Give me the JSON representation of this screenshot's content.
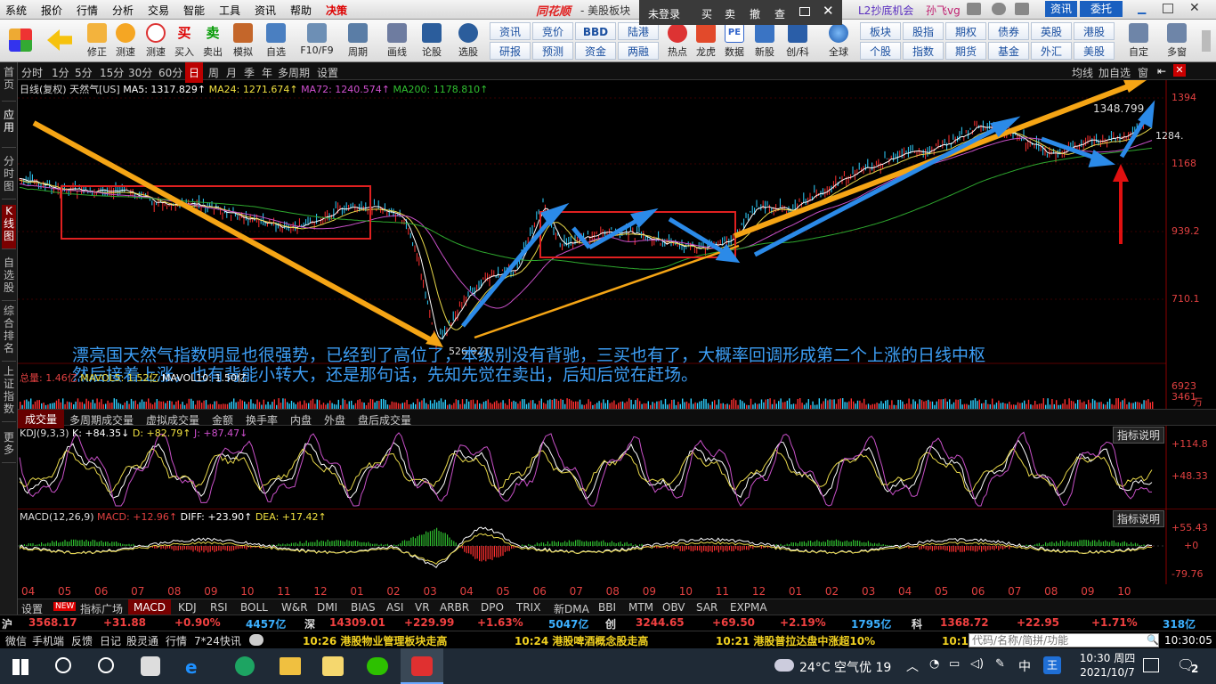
{
  "menu": {
    "items": [
      "系统",
      "报价",
      "行情",
      "分析",
      "交易",
      "智能",
      "工具",
      "资讯",
      "帮助",
      "决策"
    ],
    "app_brand": "同花顺",
    "title_suffix": "- 美股板块",
    "login": "未登录",
    "buy": "买",
    "sell": "卖",
    "cancel": "撤",
    "query": "查",
    "l2": "L2抄底机会",
    "user": "孙飞vg",
    "news_btn": "资讯",
    "trust_btn": "委托"
  },
  "toolbar": {
    "buttons": [
      {
        "label": "",
        "icon": "grid-icon"
      },
      {
        "label": "",
        "icon": "back-arrow-icon"
      },
      {
        "label": "修正",
        "icon": "updown-icon"
      },
      {
        "label": "测速",
        "icon": "speed-icon"
      },
      {
        "label": "买入",
        "icon": "buy-icon"
      },
      {
        "label": "卖出",
        "icon": "sell-icon"
      },
      {
        "label": "模拟",
        "icon": "hammer-icon"
      },
      {
        "label": "自选",
        "icon": "star-icon"
      },
      {
        "label": "F10/F9",
        "icon": "f10-icon"
      },
      {
        "label": "周期",
        "icon": "clock-icon"
      },
      {
        "label": "画线",
        "icon": "pen-icon"
      },
      {
        "label": "论股",
        "icon": "discuss-icon"
      },
      {
        "label": "选股",
        "icon": "search-icon"
      }
    ],
    "quick_top": [
      "资讯",
      "竞价",
      "BBD",
      "陆港"
    ],
    "quick_bottom": [
      "研报",
      "预测",
      "资金",
      "两融"
    ],
    "more": [
      {
        "label": "热点",
        "icon": "hot-icon"
      },
      {
        "label": "龙虎",
        "icon": "dragon-icon"
      },
      {
        "label": "数据",
        "icon": "pe-icon"
      },
      {
        "label": "新股",
        "icon": "newstock-icon"
      },
      {
        "label": "创/科",
        "icon": "chuang-icon"
      },
      {
        "label": "全球",
        "icon": "globe-icon"
      }
    ],
    "right_top": [
      "板块",
      "股指",
      "期权",
      "债券",
      "英股",
      "港股"
    ],
    "right_bottom": [
      "个股",
      "指数",
      "期货",
      "基金",
      "外汇",
      "美股"
    ],
    "custom": "自定",
    "multi": "多窗"
  },
  "left_nav": [
    "首页",
    "应用",
    "分时图",
    "K线图",
    "自选股",
    "综合排名",
    "上证指数",
    "更多"
  ],
  "periods": [
    "分时",
    "1分",
    "5分",
    "15分",
    "30分",
    "60分",
    "日",
    "周",
    "月",
    "季",
    "年",
    "多周期",
    "设置"
  ],
  "period_active": "日",
  "period_right": [
    "均线",
    "加自选",
    "窗"
  ],
  "main": {
    "legend_prefix": "日线(复权)",
    "name": "天然气[US]",
    "ma5": "MA5: 1317.829↑",
    "ma24": "MA24: 1271.674↑",
    "ma72": "MA72: 1240.574↑",
    "ma200": "MA200: 1178.810↑",
    "price_axis": [
      "1394",
      "1168",
      "939.2",
      "710.1"
    ],
    "high_label": "1348.799",
    "low_label": "526.921",
    "last_label": "1284.",
    "annotation1": "漂亮国天然气指数明显也很强势，已经到了高位了，本级别没有背驰，三买也有了，大概率回调形成第二个上涨的日线中枢",
    "annotation2": "然后接着上涨，也有背能小转大，还是那句话，先知先觉在卖出，后知后觉在赶场。"
  },
  "volume": {
    "label": "总量: 1.46亿",
    "mavol5": "MAVOL5: 1.52亿",
    "mavol10": "MAVOL10: 1.50亿",
    "axis": [
      "6923",
      "3461",
      "万"
    ]
  },
  "vol_tabs": [
    "成交量",
    "多周期成交量",
    "虚拟成交量",
    "金额",
    "换手率",
    "内盘",
    "外盘",
    "盘后成交量"
  ],
  "kdj": {
    "title": "KDJ(9,3,3)",
    "k": "K: +84.35↓",
    "d": "D: +82.79↑",
    "j": "J: +87.47↓",
    "axis": [
      "+114.8",
      "+48.33"
    ],
    "btn": "指标说明"
  },
  "macd": {
    "title": "MACD(12,26,9)",
    "macd": "MACD: +12.96↑",
    "diff": "DIFF: +23.90↑",
    "dea": "DEA: +17.42↑",
    "axis": [
      "+55.43",
      "+0",
      "-79.76"
    ],
    "btn": "指标说明"
  },
  "months": [
    "04",
    "05",
    "06",
    "07",
    "08",
    "09",
    "10",
    "11",
    "12",
    "01",
    "02",
    "03",
    "04",
    "05",
    "06",
    "07",
    "08",
    "09",
    "10",
    "11",
    "12",
    "01",
    "02",
    "03",
    "04",
    "05",
    "06",
    "07",
    "08",
    "09",
    "10"
  ],
  "bottom_tabs": [
    "设置",
    "NEW",
    "指标广场",
    "MACD",
    "KDJ",
    "RSI",
    "BOLL",
    "W&R",
    "DMI",
    "BIAS",
    "ASI",
    "VR",
    "ARBR",
    "DPO",
    "TRIX",
    "新DMA",
    "BBI",
    "MTM",
    "OBV",
    "SAR",
    "EXPMA"
  ],
  "index_bar": [
    {
      "name": "沪",
      "value": "3568.17",
      "chg": "+31.88",
      "pct": "+0.90%",
      "amt": "4457亿"
    },
    {
      "name": "深",
      "value": "14309.01",
      "chg": "+229.99",
      "pct": "+1.63%",
      "amt": "5047亿"
    },
    {
      "name": "创",
      "value": "3244.65",
      "chg": "+69.50",
      "pct": "+2.19%",
      "amt": "1795亿"
    },
    {
      "name": "科",
      "value": "1368.72",
      "chg": "+22.95",
      "pct": "+1.71%",
      "amt": "318亿"
    }
  ],
  "news_left": [
    "微信",
    "手机端",
    "反馈",
    "日记",
    "股灵通",
    "行情",
    "7*24快讯"
  ],
  "news": [
    "10:26 港股物业管理板块走高",
    "10:24 港股啤酒概念股走高",
    "10:21 港股普拉达盘中涨超10%",
    "10:1"
  ],
  "code_input_placeholder": "代码/名称/简拼/功能",
  "clock": "10:30:05",
  "taskbar": {
    "weather": "24°C 空气优 19",
    "ime": "中",
    "time": "10:30 周四",
    "date": "2021/10/7",
    "notif": "2"
  }
}
